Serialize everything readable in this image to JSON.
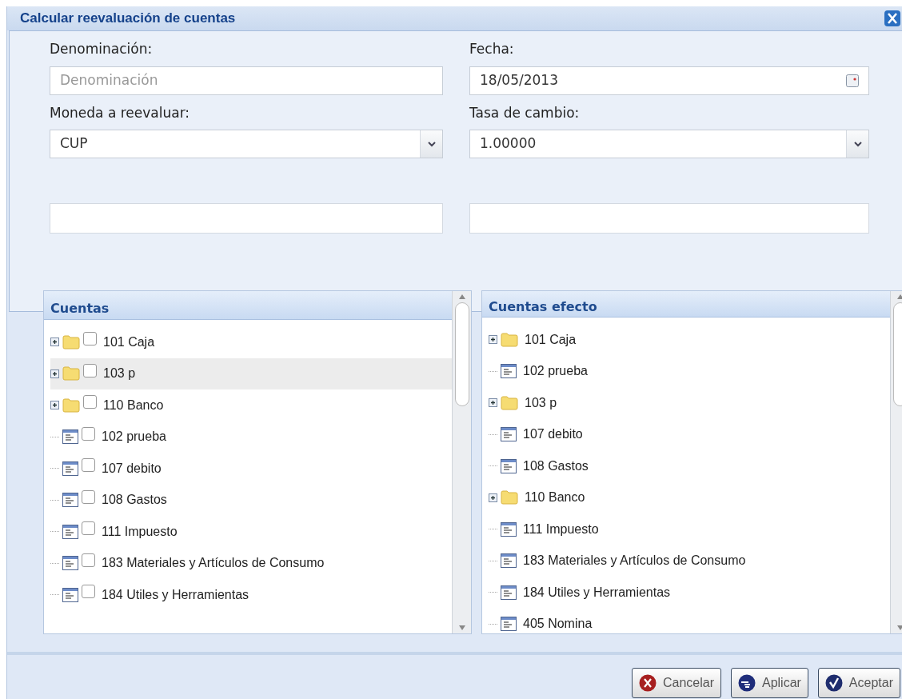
{
  "window": {
    "title": "Calcular reevaluación de cuentas"
  },
  "form": {
    "denominacion": {
      "label": "Denominación:",
      "placeholder": "Denominación"
    },
    "fecha": {
      "label": "Fecha:",
      "value": "18/05/2013"
    },
    "moneda": {
      "label": "Moneda a reevaluar:",
      "value": "CUP"
    },
    "tasa": {
      "label": "Tasa de cambio:",
      "value": "1.00000"
    }
  },
  "trees": [
    {
      "title": "Cuentas",
      "items": [
        {
          "kind": "folder",
          "label": "101 Caja",
          "checked": false,
          "selected": false
        },
        {
          "kind": "folder",
          "label": "103 p",
          "checked": false,
          "selected": true
        },
        {
          "kind": "folder",
          "label": "110 Banco",
          "checked": false,
          "selected": false
        },
        {
          "kind": "leaf",
          "label": "102 prueba",
          "checked": false,
          "selected": false
        },
        {
          "kind": "leaf",
          "label": "107 debito",
          "checked": false,
          "selected": false
        },
        {
          "kind": "leaf",
          "label": "108 Gastos",
          "checked": false,
          "selected": false
        },
        {
          "kind": "leaf",
          "label": "111 Impuesto",
          "checked": false,
          "selected": false
        },
        {
          "kind": "leaf",
          "label": "183 Materiales y Artículos de Consumo",
          "checked": false,
          "selected": false
        },
        {
          "kind": "leaf",
          "label": "184 Utiles y Herramientas",
          "checked": false,
          "selected": false
        }
      ]
    },
    {
      "title": "Cuentas efecto",
      "items": [
        {
          "kind": "folder",
          "label": "101 Caja",
          "selected": false
        },
        {
          "kind": "leaf",
          "label": "102 prueba",
          "selected": false
        },
        {
          "kind": "folder",
          "label": "103 p",
          "selected": false
        },
        {
          "kind": "leaf",
          "label": "107 debito",
          "selected": false
        },
        {
          "kind": "leaf",
          "label": "108 Gastos",
          "selected": false
        },
        {
          "kind": "folder",
          "label": "110 Banco",
          "selected": false
        },
        {
          "kind": "leaf",
          "label": "111 Impuesto",
          "selected": false
        },
        {
          "kind": "leaf",
          "label": "183 Materiales y Artículos de Consumo",
          "selected": false
        },
        {
          "kind": "leaf",
          "label": "184 Utiles y Herramientas",
          "selected": false
        },
        {
          "kind": "leaf",
          "label": "405 Nomina",
          "selected": false
        }
      ]
    }
  ],
  "buttons": [
    {
      "kind": "cancel",
      "label": "Cancelar"
    },
    {
      "kind": "apply",
      "label": "Aplicar"
    },
    {
      "kind": "accept",
      "label": "Aceptar"
    }
  ]
}
